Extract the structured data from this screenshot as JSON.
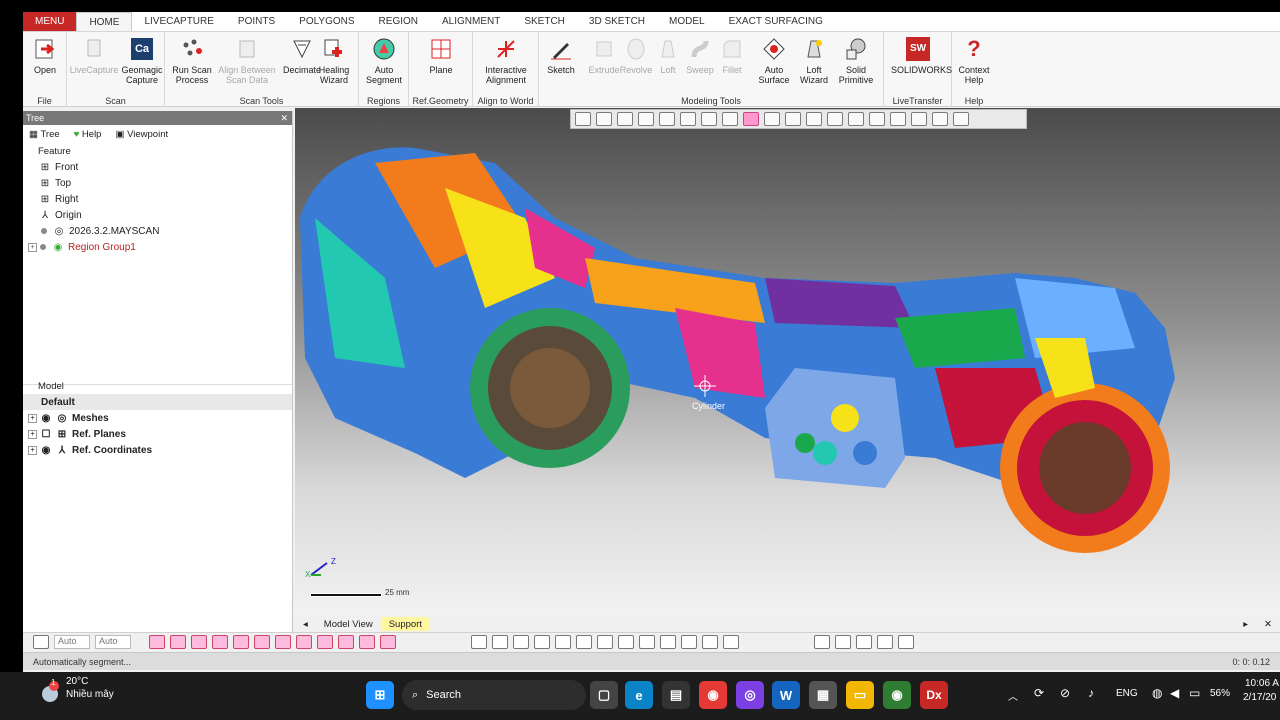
{
  "menu": {
    "label": "MENU"
  },
  "tabs": [
    "HOME",
    "LIVECAPTURE",
    "POINTS",
    "POLYGONS",
    "REGION",
    "ALIGNMENT",
    "SKETCH",
    "3D SKETCH",
    "MODEL",
    "EXACT SURFACING"
  ],
  "ribbon": {
    "groups": {
      "file": "File",
      "scan": "Scan",
      "scan_tools": "Scan Tools",
      "regions": "Regions",
      "ref_geometry": "Ref.Geometry",
      "align": "Align to World",
      "modeling": "Modeling Tools",
      "livetransfer": "LiveTransfer",
      "help": "Help"
    },
    "buttons": {
      "open": "Open",
      "livecapture": "LiveCapture",
      "geomagic_l1": "Geomagic",
      "geomagic_l2": "Capture",
      "runscan_l1": "Run Scan",
      "runscan_l2": "Process",
      "align_between_l1": "Align Between",
      "align_between_l2": "Scan Data",
      "decimate": "Decimate",
      "healing_l1": "Healing",
      "healing_l2": "Wizard",
      "autoseg_l1": "Auto",
      "autoseg_l2": "Segment",
      "plane": "Plane",
      "interactive_l1": "Interactive",
      "interactive_l2": "Alignment",
      "sketch": "Sketch",
      "extrude": "Extrude",
      "revolve": "Revolve",
      "loft": "Loft",
      "sweep": "Sweep",
      "fillet": "Fillet",
      "autosurf_l1": "Auto",
      "autosurf_l2": "Surface",
      "loftwiz_l1": "Loft",
      "loftwiz_l2": "Wizard",
      "solidprim_l1": "Solid",
      "solidprim_l2": "Primitive",
      "solidworks": "SOLIDWORKS",
      "context_l1": "Context",
      "context_l2": "Help"
    },
    "icon_text": {
      "ca": "Ca",
      "sw": "SW",
      "question": "?"
    }
  },
  "tree": {
    "title": "Tree",
    "tab_tree": "Tree",
    "tab_help": "Help",
    "tab_viewpoint": "Viewpoint",
    "feature_label": "Feature",
    "items": [
      "Front",
      "Top",
      "Right",
      "Origin",
      "2026.3.2.MAYSCAN",
      "Region Group1"
    ]
  },
  "model": {
    "label": "Model",
    "default": "Default",
    "items": [
      "Meshes",
      "Ref. Planes",
      "Ref. Coordinates"
    ]
  },
  "viewport": {
    "cursor_label": "Cylinder",
    "scale_label": "25 mm",
    "axis_x": "X",
    "axis_z": "Z"
  },
  "bottom_tabs": [
    "Model View",
    "Support"
  ],
  "bottom_toolbar": {
    "auto1": "Auto",
    "auto2": "Auto"
  },
  "status": {
    "left": "Automatically segment...",
    "right": "0: 0: 0.12"
  },
  "taskbar": {
    "weather_temp": "20°C",
    "weather_desc": "Nhiều mây",
    "weather_badge": "1",
    "search": "Search",
    "dx": "Dx",
    "language": "ENG",
    "battery": "56%",
    "time": "10:06 A",
    "date": "2/17/20"
  },
  "colors": {
    "menu_red": "#c62828",
    "highlight_yellow": "#fff7a0",
    "taskbar_bg": "#1c1c1c"
  }
}
